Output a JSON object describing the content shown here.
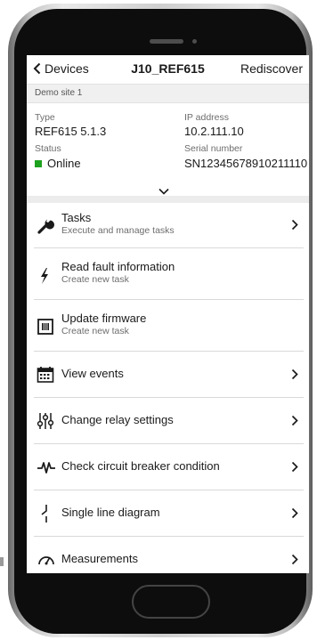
{
  "nav": {
    "back_label": "Devices",
    "title": "J10_REF615",
    "action_label": "Rediscover"
  },
  "site": "Demo site 1",
  "device": {
    "type_label": "Type",
    "type_value": "REF615  5.1.3",
    "ip_label": "IP address",
    "ip_value": "10.2.111.10",
    "status_label": "Status",
    "status_value": "Online",
    "status_color": "#1ea11e",
    "serial_label": "Serial number",
    "serial_value": "SN12345678910211110"
  },
  "menu": [
    {
      "icon": "wrench-icon",
      "title": "Tasks",
      "subtitle": "Execute and manage tasks",
      "chevron": true
    },
    {
      "icon": "lightning-icon",
      "title": "Read fault information",
      "subtitle": "Create new task",
      "chevron": false
    },
    {
      "icon": "chip-icon",
      "title": "Update firmware",
      "subtitle": "Create new task",
      "chevron": false
    },
    {
      "icon": "calendar-icon",
      "title": "View events",
      "subtitle": "",
      "chevron": true
    },
    {
      "icon": "sliders-icon",
      "title": "Change relay settings",
      "subtitle": "",
      "chevron": true
    },
    {
      "icon": "waveform-icon",
      "title": "Check circuit breaker condition",
      "subtitle": "",
      "chevron": true
    },
    {
      "icon": "single-line-icon",
      "title": "Single line diagram",
      "subtitle": "",
      "chevron": true
    },
    {
      "icon": "gauge-icon",
      "title": "Measurements",
      "subtitle": "",
      "chevron": true
    }
  ]
}
